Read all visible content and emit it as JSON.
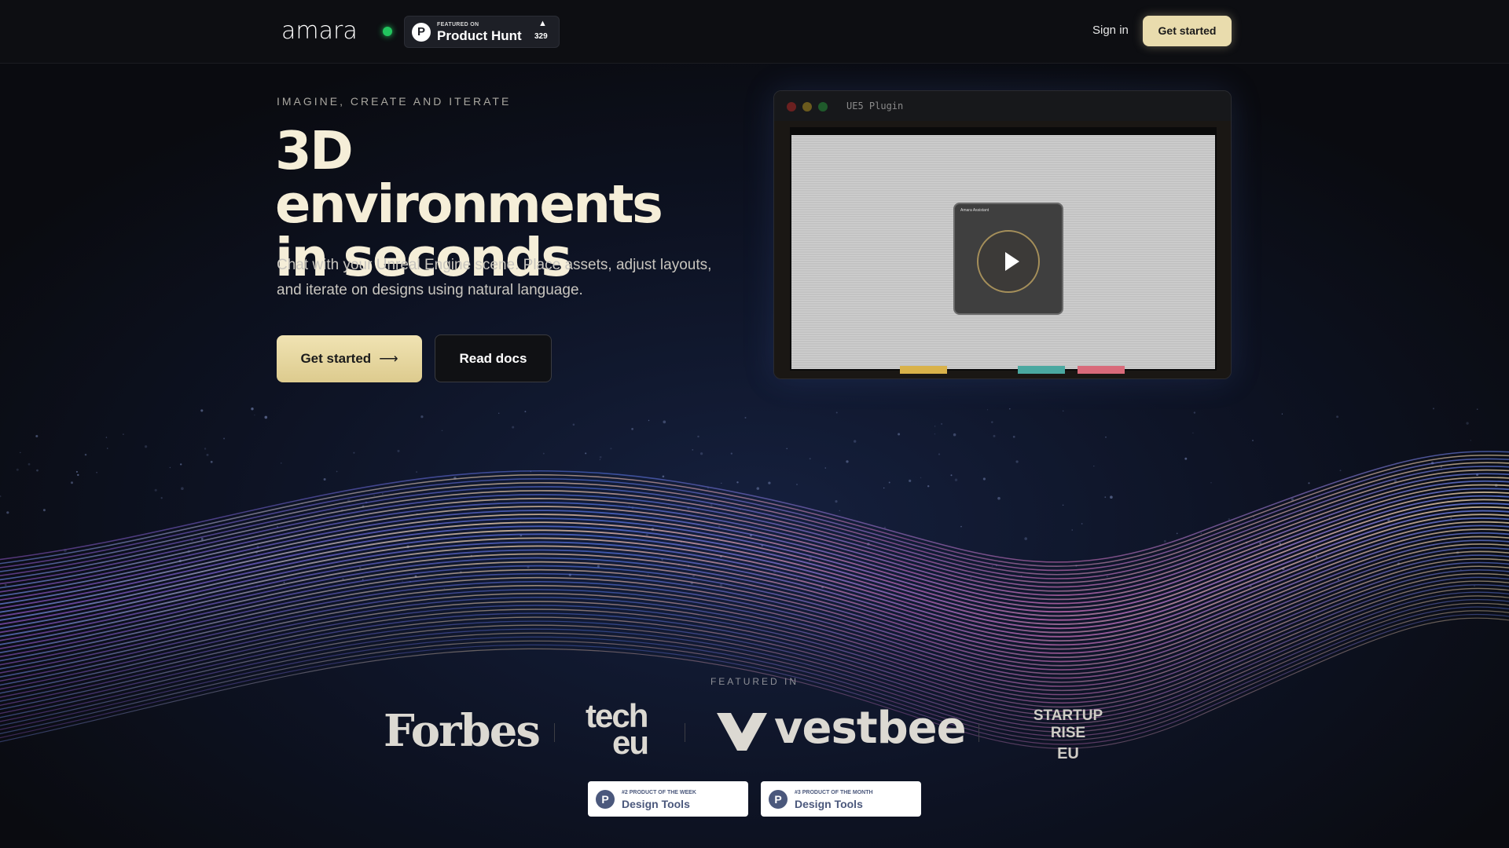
{
  "nav": {
    "logo": "amara",
    "product_hunt": {
      "featured": "FEATURED ON",
      "name": "Product Hunt",
      "count": "329"
    },
    "sign_in": "Sign in",
    "get_started": "Get started"
  },
  "hero": {
    "eyebrow": "IMAGINE, CREATE AND ITERATE",
    "title_line1": "3D environments",
    "title_line2": "in seconds",
    "subtitle": "Chat with your Unreal Engine scene. Place assets, adjust layouts, and iterate on designs using natural language.",
    "primary_cta": "Get started",
    "secondary_cta": "Read docs"
  },
  "video": {
    "window_title": "UE5 Plugin",
    "panel_title": "Amara Assistant"
  },
  "featured": {
    "label": "FEATURED IN",
    "logos": {
      "forbes": "Forbes",
      "tech": "tech",
      "eu": "eu",
      "vestbee": "vestbee",
      "startup_line1": "STARTUP RISE",
      "startup_line2": "EU"
    },
    "awards": [
      {
        "small": "#2 PRODUCT OF THE WEEK",
        "big": "Design Tools"
      },
      {
        "small": "#3 PRODUCT OF THE MONTH",
        "big": "Design Tools"
      }
    ]
  },
  "colors": {
    "accent": "#e9dcad",
    "background": "#0b0d14",
    "status": "#22c55e",
    "ph_award": "#4b587c"
  },
  "icons": [
    "product-hunt-icon",
    "upvote-arrow-icon",
    "arrow-right-icon",
    "play-icon",
    "vestbee-mark-icon"
  ]
}
